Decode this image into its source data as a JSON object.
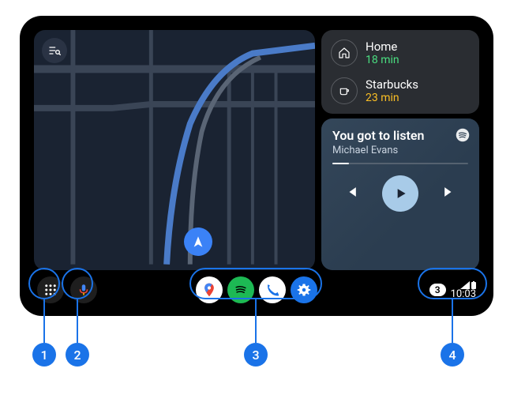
{
  "destinations": [
    {
      "name": "Home",
      "eta": "18 min",
      "etaClass": "eta-green",
      "icon": "home"
    },
    {
      "name": "Starbucks",
      "eta": "23 min",
      "etaClass": "eta-yellow",
      "icon": "cup"
    }
  ],
  "media": {
    "title": "You got to listen",
    "artist": "Michael Evans",
    "provider": "spotify"
  },
  "status": {
    "notifications": "3",
    "time": "10:03"
  },
  "callouts": [
    "1",
    "2",
    "3",
    "4"
  ]
}
